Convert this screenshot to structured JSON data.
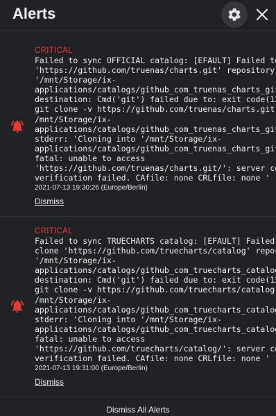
{
  "header": {
    "title": "Alerts"
  },
  "alerts": [
    {
      "level": "CRITICAL",
      "message": "Failed to sync OFFICIAL catalog: [EFAULT] Failed to clone\n'https://github.com/truenas/charts.git' repository at\n'/mnt/Storage/ix-\napplications/catalogs/github_com_truenas_charts_git_master'\ndestination: Cmd('git') failed due to: exit code(128) cmdline:\ngit clone -v https://github.com/truenas/charts.git\n/mnt/Storage/ix-\napplications/catalogs/github_com_truenas_charts_git_master\nstderr: 'Cloning into '/mnt/Storage/ix-\napplications/catalogs/github_com_truenas_charts_git_master'...\nfatal: unable to access\n'https://github.com/truenas/charts.git/': server certificate\nverification failed. CAfile: none CRLfile: none '",
      "timestamp": "2021-07-13 19:30:26 (Europe/Berlin)",
      "dismiss_label": "Dismiss"
    },
    {
      "level": "CRITICAL",
      "message": "Failed to sync TRUECHARTS catalog: [EFAULT] Failed to\nclone 'https://github.com/truecharts/catalog' repository at\n'/mnt/Storage/ix-\napplications/catalogs/github_com_truecharts_catalog_main'\ndestination: Cmd('git') failed due to: exit code(128) cmdline:\ngit clone -v https://github.com/truecharts/catalog\n/mnt/Storage/ix-\napplications/catalogs/github_com_truecharts_catalog_main\nstderr: 'Cloning into '/mnt/Storage/ix-\napplications/catalogs/github_com_truecharts_catalog_main'...\nfatal: unable to access\n'https://github.com/truecharts/catalog/': server certificate\nverification failed. CAfile: none CRLfile: none '",
      "timestamp": "2021-07-13 19:31:00 (Europe/Berlin)",
      "dismiss_label": "Dismiss"
    }
  ],
  "footer": {
    "dismiss_all_label": "Dismiss All Alerts"
  },
  "colors": {
    "background": "#202124",
    "critical": "#e53935",
    "text": "#f1f1f1"
  },
  "icons": {
    "settings": "gear-icon",
    "close": "close-icon",
    "alert": "bell-alert-icon"
  }
}
